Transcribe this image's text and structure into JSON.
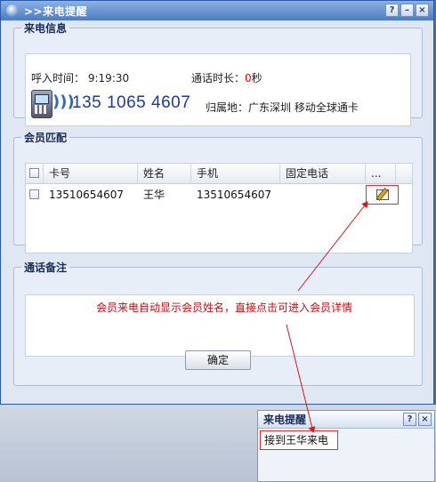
{
  "window": {
    "title": ">>来电提醒",
    "buttons": [
      "?",
      "–",
      "×"
    ]
  },
  "call_info": {
    "legend": "来电信息",
    "incoming_time_label": "呼入时间：",
    "incoming_time": "9:19:30",
    "duration_label": "通话时长：",
    "duration_value": "0",
    "duration_unit": "秒",
    "phone_number": "135 1065 4607",
    "region_label": "归属地：",
    "region": "广东深圳 移动全球通卡"
  },
  "member_match": {
    "legend": "会员匹配",
    "columns": [
      "卡号",
      "姓名",
      "手机",
      "固定电话",
      "..."
    ],
    "rows": [
      {
        "card_no": "13510654607",
        "name": "王华",
        "mobile": "13510654607",
        "landline": ""
      }
    ]
  },
  "notes": {
    "legend": "通话备注",
    "annotation": "会员来电自动显示会员姓名，直接点击可进入会员详情"
  },
  "ok_button": "确定",
  "popup": {
    "title": "来电提醒",
    "message": "接到王华来电",
    "buttons": [
      "?",
      "×"
    ]
  },
  "colors": {
    "accent": "#2c5aa5",
    "annotation": "#c0101a",
    "highlight_border": "#e03030"
  }
}
